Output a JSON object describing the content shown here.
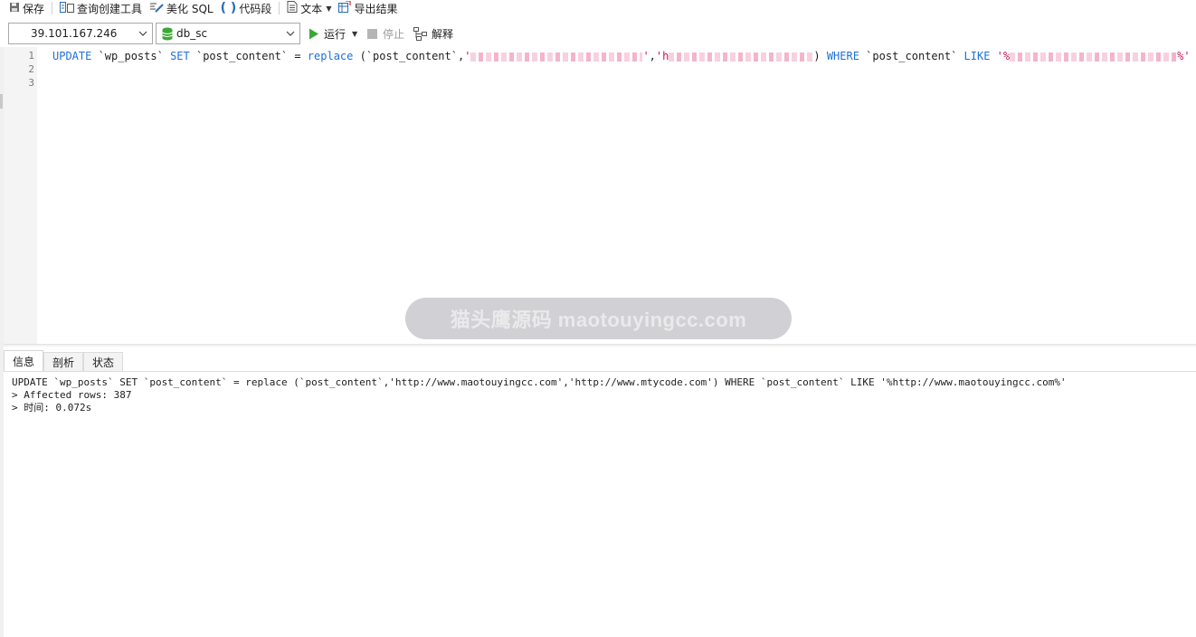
{
  "toolbar": {
    "save": "保存",
    "query_builder": "查询创建工具",
    "beautify_sql": "美化 SQL",
    "code_snippet": "代码段",
    "text": "文本",
    "export_results": "导出结果"
  },
  "connection": {
    "server": "39.101.167.246",
    "database": "db_sc",
    "run": "运行",
    "stop": "停止",
    "explain": "解释"
  },
  "editor": {
    "line_numbers": [
      "1",
      "2",
      "3"
    ],
    "tokens": {
      "update": "UPDATE",
      "table": " `wp_posts` ",
      "set": "SET",
      "column_assign": " `post_content` = ",
      "replace_fn": "replace",
      "replace_arg": " (`post_content`,",
      "str1_open": "'",
      "str1_close": "'",
      "comma": ",",
      "str2_open": "'h",
      "str2_close": ")",
      "where": " WHERE",
      "where_col": " `post_content` ",
      "like": "LIKE",
      "str3_open": " '%",
      "str3_close": "%'"
    }
  },
  "watermark": "猫头鹰源码 maotouyingcc.com",
  "results": {
    "tabs": [
      "信息",
      "剖析",
      "状态"
    ],
    "active_tab": 0,
    "lines": [
      "UPDATE `wp_posts` SET `post_content` = replace (`post_content`,'http://www.maotouyingcc.com','http://www.mtycode.com') WHERE `post_content` LIKE '%http://www.maotouyingcc.com%'",
      "> Affected rows: 387",
      "> 时间: 0.072s"
    ]
  },
  "colors": {
    "keyword": "#1f6fd8",
    "string": "#c2185b",
    "run_icon": "#3aa935",
    "db_icon": "#3aa935"
  }
}
